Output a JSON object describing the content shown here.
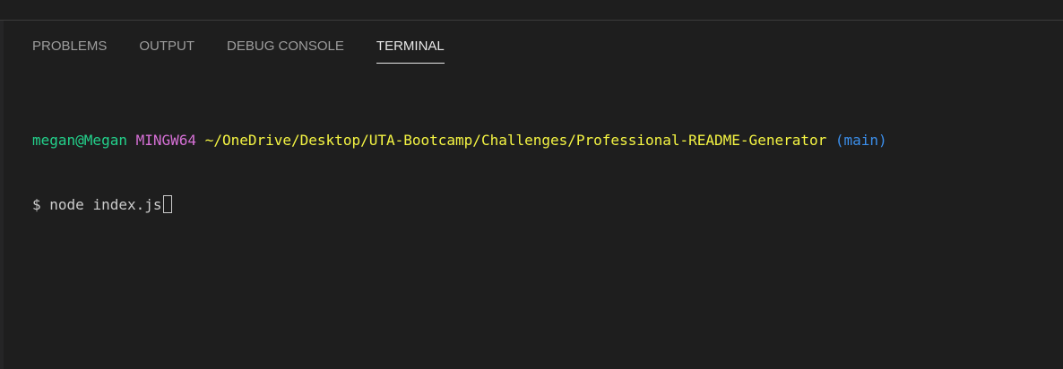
{
  "panel": {
    "tabs": [
      {
        "label": "PROBLEMS"
      },
      {
        "label": "OUTPUT"
      },
      {
        "label": "DEBUG CONSOLE"
      },
      {
        "label": "TERMINAL"
      }
    ]
  },
  "terminal": {
    "user": "megan@Megan",
    "host": "MINGW64",
    "path": "~/OneDrive/Desktop/UTA-Bootcamp/Challenges/Professional-README-Generator",
    "branch": "(main)",
    "prompt": "$",
    "command": "node index.js"
  },
  "colors": {
    "background": "#1e1e1e",
    "user": "#23d18b",
    "host": "#d670d6",
    "path": "#f5f543",
    "branch": "#3b8eea",
    "text": "#cccccc"
  }
}
